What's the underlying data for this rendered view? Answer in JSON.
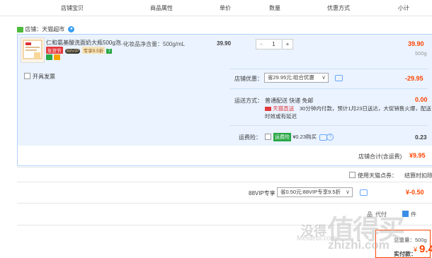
{
  "header": {
    "columns": [
      "店铺宝贝",
      "商品属性",
      "单价",
      "数量",
      "优惠方式",
      "小计"
    ]
  },
  "shop": {
    "label": "店铺：天猫超市"
  },
  "item": {
    "name": "仁和氨基酸洗面奶大瓶500g泡…",
    "attr": "化妆品净含量：500g/mL",
    "price": "39.90",
    "quantity": "1",
    "minus": "−",
    "plus": "+",
    "subtotal": "39.90",
    "weight": "500g",
    "badges": {
      "festival": "年货节",
      "vip": "88VIP",
      "vip_off": "专享9.5折",
      "seven": "7"
    }
  },
  "invoice": {
    "label": "开具发票"
  },
  "shop_discount": {
    "label": "店铺优惠：",
    "selected": "省29.95元:组合优惠",
    "amount": "-29.95"
  },
  "shipping": {
    "label": "运送方式：",
    "method": "普通配送 快递 免邮",
    "fee": "0.00",
    "tag": "天猫直送",
    "note_line1": "30分钟内付款，预计1月23日送达，大促销售火爆，配送",
    "note_line2": "时效或有延迟"
  },
  "insurance": {
    "label": "运费险：",
    "tag": "运费险",
    "price": "¥0.23购买",
    "amount": "0.23"
  },
  "shop_total": {
    "label": "店铺合计(含运费)",
    "amount": "¥9.95"
  },
  "points": {
    "label": "使用天猫点券：",
    "extra": "结算时扣除"
  },
  "vip": {
    "label": "88VIP专享",
    "selected": "省0.50元:88VIP专享9.5折",
    "amount": "¥-0.50"
  },
  "footer": {
    "partial_a": "品",
    "partial_b": "代付",
    "partial_c": "件",
    "weight_note": "总重量：500g",
    "pay_label": "实付款：",
    "currency": "¥",
    "pay_amount": "9.45"
  },
  "watermark": {
    "zh": "值得买",
    "en": "zhizhi.com",
    "left": "没得",
    "left_en": "Meidebi.com"
  },
  "colors": {
    "accent": "#ff4400",
    "select_blue": "#b2d1ff",
    "row_blue": "#eaf3ff"
  }
}
